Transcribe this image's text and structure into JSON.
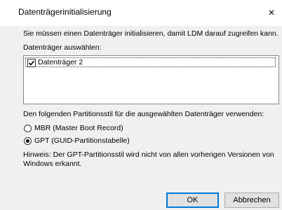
{
  "dialog": {
    "title": "Datenträgerinitialisierung",
    "close_glyph": "×"
  },
  "content": {
    "intro": "Sie müssen einen Datenträger initialisieren, damit LDM darauf zugreifen kann.",
    "select_label": "Datenträger auswählen:",
    "disks": [
      {
        "label": "Datenträger 2",
        "checked": true
      }
    ],
    "partition_style_label": "Den folgenden Partitionsstil für die ausgewählten Datenträger verwenden:",
    "options": [
      {
        "label": "MBR (Master Boot Record)",
        "selected": false
      },
      {
        "label": "GPT (GUID-Partitionstabelle)",
        "selected": true
      }
    ],
    "hint_line1": "Hinweis: Der GPT-Partitionsstil wird nicht von allen vorherigen Versionen von",
    "hint_line2": "Windows erkannt."
  },
  "buttons": {
    "ok": "OK",
    "cancel": "Abbrechen"
  },
  "colors": {
    "default_button_border": "#0078d7",
    "client_bg": "#f0f0f0"
  }
}
